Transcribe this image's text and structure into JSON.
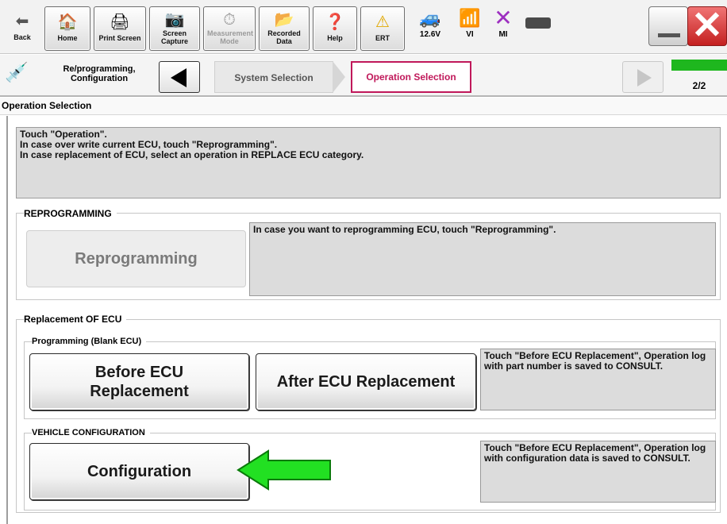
{
  "toolbar": {
    "back": "Back",
    "home": "Home",
    "print_screen": "Print Screen",
    "screen_capture": "Screen Capture",
    "measurement_mode": "Measurement Mode",
    "recorded_data": "Recorded Data",
    "help": "Help",
    "ert": "ERT",
    "voltage": "12.6V",
    "vi": "VI",
    "mi": "MI"
  },
  "nav": {
    "title": "Re/programming, Configuration",
    "crumb_system": "System Selection",
    "crumb_operation": "Operation Selection",
    "page": "2/2",
    "page_progress": 1.0
  },
  "section_title": "Operation Selection",
  "instructions": [
    "Touch \"Operation\".",
    "In case over write current ECU, touch \"Reprogramming\".",
    "In case replacement of ECU, select an operation in REPLACE ECU category."
  ],
  "reprogramming": {
    "group_label": "REPROGRAMMING",
    "button": "Reprogramming",
    "description": "In case you want to reprogramming ECU, touch \"Reprogramming\"."
  },
  "replacement": {
    "group_label": "Replacement OF ECU",
    "programming_label": "Programming (Blank ECU)",
    "before_button": "Before ECU Replacement",
    "after_button": "After ECU Replacement",
    "programming_description": "Touch \"Before ECU Replacement\", Operation log with part number is saved to CONSULT.",
    "vehicle_config_label": "VEHICLE CONFIGURATION",
    "configuration_button": "Configuration",
    "config_description": "Touch \"Before ECU Replacement\", Operation log with configuration data is saved to CONSULT."
  },
  "colors": {
    "accent": "#c0185a",
    "progress": "#1eb71e",
    "arrow": "#22e022"
  }
}
